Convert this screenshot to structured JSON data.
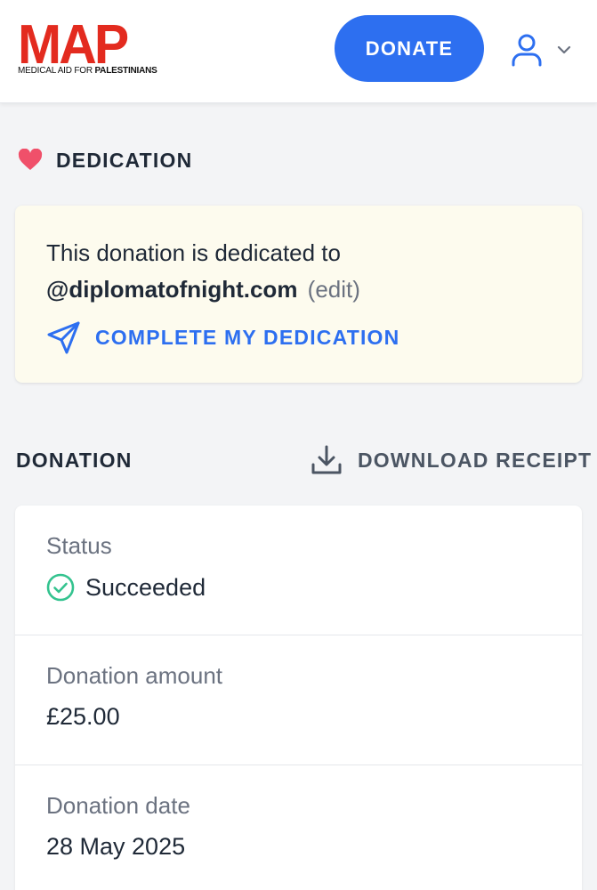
{
  "brand": {
    "logo_mark": "MAP",
    "logo_sub_regular": "MEDICAL AID FOR ",
    "logo_sub_bold": "PALESTINIANS",
    "accent_color": "#e32b1f"
  },
  "header": {
    "donate_label": "DONATE",
    "donate_color": "#2d6ff0",
    "user_icon": "user-icon",
    "menu_icon": "chevron-down-icon"
  },
  "dedication": {
    "heading_icon": "heart-icon",
    "title": "DEDICATION",
    "text": "This donation is dedicated to",
    "recipient": "@diplomatofnight.com",
    "edit_label": "(edit)",
    "action_icon": "send-icon",
    "action_label": "COMPLETE MY DEDICATION"
  },
  "donation": {
    "title": "DONATION",
    "receipt_icon": "download-icon",
    "receipt_label": "DOWNLOAD RECEIPT",
    "rows": [
      {
        "label": "Status",
        "value": "Succeeded",
        "icon": "check-circle-icon",
        "icon_color": "#34c38f"
      },
      {
        "label": "Donation amount",
        "value": "£25.00"
      },
      {
        "label": "Donation date",
        "value": "28 May 2025"
      }
    ]
  }
}
